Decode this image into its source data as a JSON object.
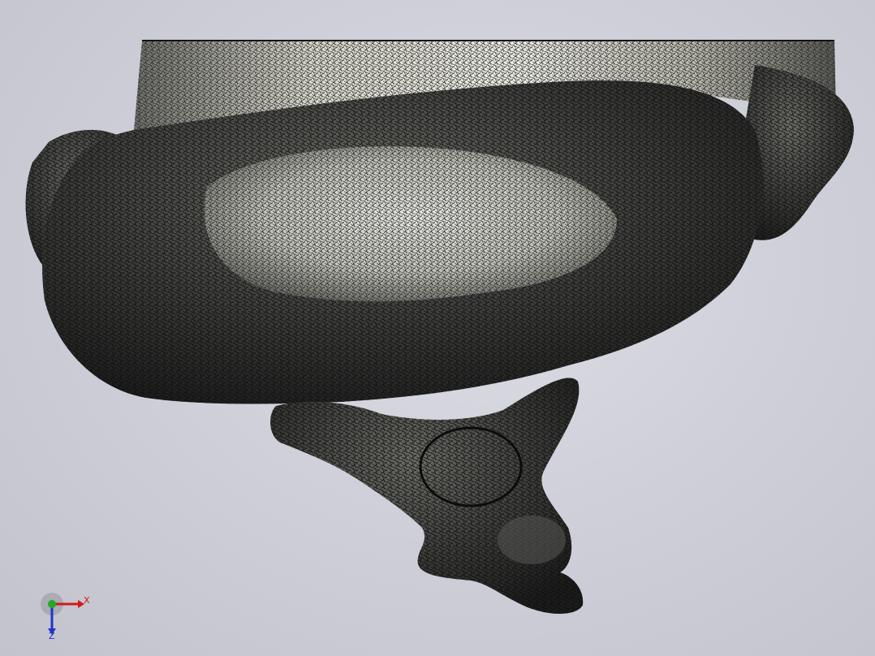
{
  "viewport": {
    "background_color": "#cfd0d9",
    "model_color": "#3a3a3a",
    "mesh_line_color": "#111111",
    "highlight_color": "#e8e8e0"
  },
  "triad": {
    "x_label": "X",
    "z_label": "Z",
    "x_color": "#d11a1a",
    "y_color": "#22aa22",
    "z_color": "#2233cc"
  }
}
